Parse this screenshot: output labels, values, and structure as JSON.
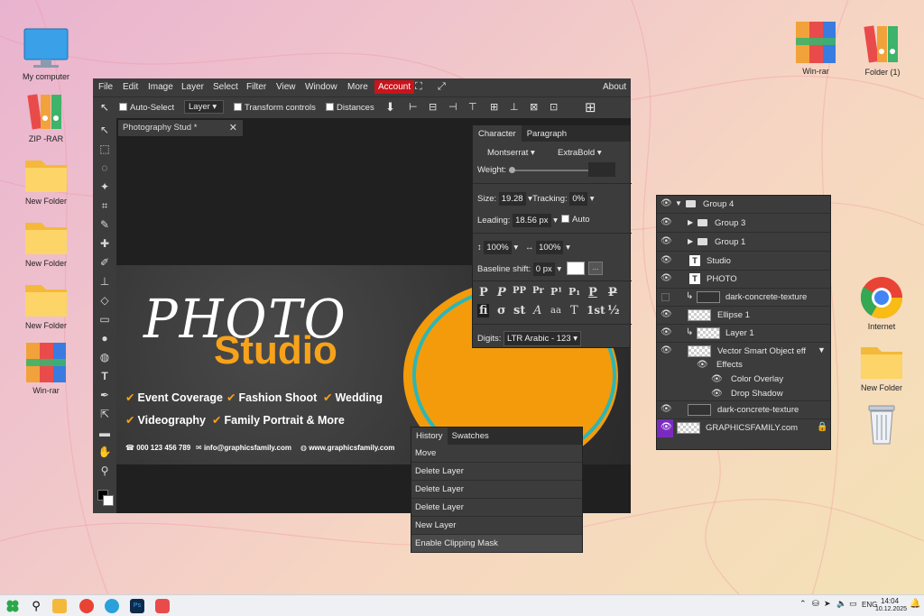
{
  "desktop": {
    "left_icons": [
      {
        "label": "My computer",
        "icon": "monitor-icon"
      },
      {
        "label": "ZIP -RAR",
        "icon": "archive-books-icon"
      },
      {
        "label": "New Folder",
        "icon": "folder-icon"
      },
      {
        "label": "New Folder",
        "icon": "folder-icon"
      },
      {
        "label": "New Folder",
        "icon": "folder-icon"
      },
      {
        "label": "Win-rar",
        "icon": "winrar-icon"
      }
    ],
    "right_icons": [
      {
        "label": "Win-rar",
        "icon": "winrar-icon"
      },
      {
        "label": "Folder (1)",
        "icon": "archive-books-icon"
      },
      {
        "label": "Internet",
        "icon": "chrome-icon"
      },
      {
        "label": "New Folder",
        "icon": "folder-icon"
      },
      {
        "label": "",
        "icon": "recycle-bin-icon"
      }
    ]
  },
  "app": {
    "menu": [
      "File",
      "Edit",
      "Image",
      "Layer",
      "Select",
      "Filter",
      "View",
      "Window",
      "More"
    ],
    "account": "Account",
    "about": "About",
    "options": {
      "auto_select": "Auto-Select",
      "layer_select": "Layer",
      "transform_controls": "Transform controls",
      "distances": "Distances"
    },
    "doc_tab": "Photography Stud  *",
    "canvas": {
      "photo": "PHOTO",
      "studio": "Studio",
      "services_row1": [
        "Event Coverage",
        "Fashion Shoot",
        "Wedding"
      ],
      "services_row2": [
        "Videography",
        "Family Portrait & More"
      ],
      "phone": "000 123 456 789",
      "email": "info@graphicsfamily.com",
      "web": "www.graphicsfamily.com"
    }
  },
  "character_panel": {
    "tabs": [
      "Character",
      "Paragraph"
    ],
    "font_family": "Montserrat",
    "font_style": "ExtraBold",
    "weight_label": "Weight:",
    "size_label": "Size:",
    "size": "19.28",
    "tracking_label": "Tracking:",
    "tracking": "0%",
    "leading_label": "Leading:",
    "leading": "18.56 px",
    "auto_label": "Auto",
    "vscale": "100%",
    "hscale": "100%",
    "baseline_label": "Baseline shift:",
    "baseline": "0 px",
    "more": "...",
    "glyphs_row1": [
      "P",
      "P",
      "PP",
      "Pr",
      "P¹",
      "P₁",
      "P",
      "P"
    ],
    "glyphs_row2": [
      "fi",
      "σ",
      "st",
      "A",
      "aa",
      "T",
      "1st",
      "½"
    ],
    "digits_label": "Digits:",
    "digits": "LTR Arabic - 123"
  },
  "history_panel": {
    "tabs": [
      "History",
      "Swatches"
    ],
    "items": [
      "Move",
      "Delete Layer",
      "Delete Layer",
      "Delete Layer",
      "New Layer",
      "Enable Clipping Mask"
    ]
  },
  "layers_panel": {
    "layers": [
      {
        "name": "Group 4",
        "type": "group-open"
      },
      {
        "name": "Group 3",
        "type": "group"
      },
      {
        "name": "Group 1",
        "type": "group"
      },
      {
        "name": "Studio",
        "type": "text"
      },
      {
        "name": "PHOTO",
        "type": "text"
      },
      {
        "name": "dark-concrete-texture",
        "type": "smart-clip"
      },
      {
        "name": "Ellipse 1",
        "type": "raster"
      },
      {
        "name": "Layer 1",
        "type": "raster-clip"
      },
      {
        "name": "Vector Smart Object eff",
        "type": "smart"
      },
      {
        "name": "Effects",
        "type": "effects"
      },
      {
        "name": "Color Overlay",
        "type": "effect"
      },
      {
        "name": "Drop Shadow",
        "type": "effect"
      },
      {
        "name": "dark-concrete-texture",
        "type": "smart"
      },
      {
        "name": "GRAPHICSFAMILY.com",
        "type": "locked"
      }
    ]
  },
  "taskbar": {
    "lang": "ENG",
    "time": "14:04",
    "date": "10.12.2025"
  },
  "colors": {
    "accent_red": "#c8141b",
    "orange": "#f7a21b",
    "panel": "#3c3c3c"
  }
}
